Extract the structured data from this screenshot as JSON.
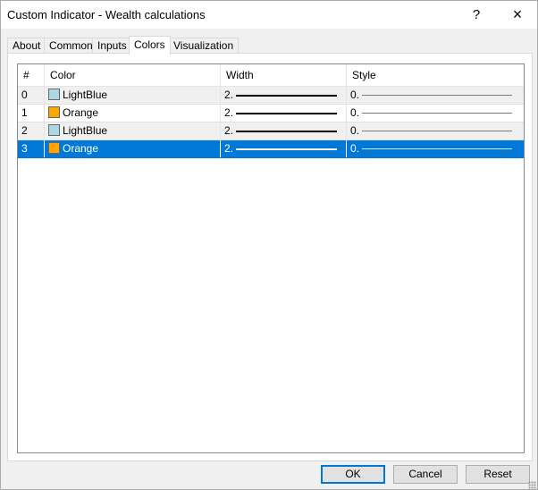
{
  "window": {
    "title": "Custom Indicator - Wealth calculations",
    "help": "?",
    "close": "×"
  },
  "tabs": [
    {
      "label": "About"
    },
    {
      "label": "Common"
    },
    {
      "label": "Inputs"
    },
    {
      "label": "Colors",
      "active": true
    },
    {
      "label": "Visualization"
    }
  ],
  "table": {
    "columns": [
      "#",
      "Color",
      "Width",
      "Style"
    ],
    "rows": [
      {
        "index": "0",
        "color_name": "LightBlue",
        "swatch": "#add8e6",
        "width": "2.",
        "style": "0."
      },
      {
        "index": "1",
        "color_name": "Orange",
        "swatch": "#ffa500",
        "width": "2.",
        "style": "0."
      },
      {
        "index": "2",
        "color_name": "LightBlue",
        "swatch": "#add8e6",
        "width": "2.",
        "style": "0."
      },
      {
        "index": "3",
        "color_name": "Orange",
        "swatch": "#ffa500",
        "width": "2.",
        "style": "0.",
        "selected": true
      }
    ]
  },
  "buttons": {
    "ok": "OK",
    "cancel": "Cancel",
    "reset": "Reset"
  },
  "colors": {
    "selection": "#0078d7",
    "default_button_border": "#0078d7"
  }
}
